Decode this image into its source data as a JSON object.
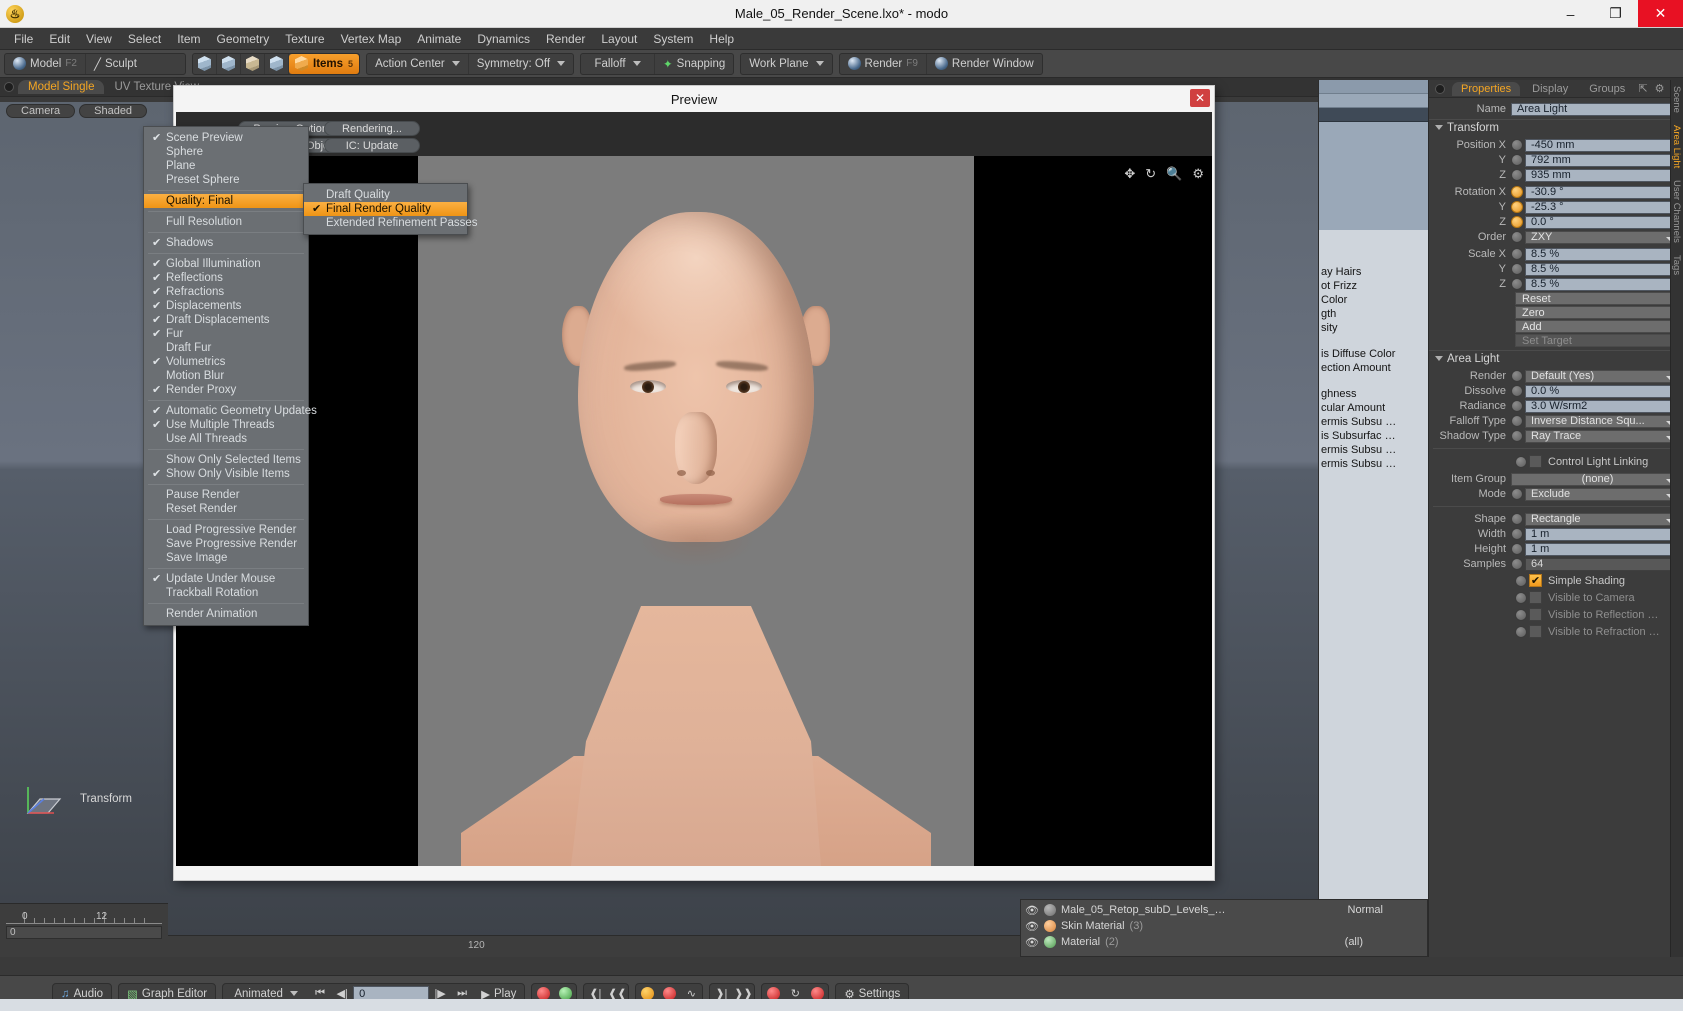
{
  "window": {
    "title": "Male_05_Render_Scene.lxo* - modo",
    "minimize": "–",
    "maximize": "❐",
    "close": "✕"
  },
  "menubar": [
    "File",
    "Edit",
    "View",
    "Select",
    "Item",
    "Geometry",
    "Texture",
    "Vertex Map",
    "Animate",
    "Dynamics",
    "Render",
    "Layout",
    "System",
    "Help"
  ],
  "toolbar": {
    "model": "Model",
    "model_key": "F2",
    "sculpt": "Sculpt",
    "items": "Items",
    "items_badge": "5",
    "action_center": "Action Center",
    "symmetry": "Symmetry: Off",
    "falloff": "Falloff",
    "snapping": "Snapping",
    "work_plane": "Work Plane",
    "render": "Render",
    "render_key": "F9",
    "render_window": "Render Window"
  },
  "layout_tabs": [
    {
      "label": "Model Single",
      "active": true
    },
    {
      "label": "UV Texture View",
      "active": false
    }
  ],
  "viewport": {
    "tabs": [
      "Camera",
      "Shaded"
    ],
    "transform_label": "Transform",
    "ruler_labels": [
      "0",
      "12"
    ],
    "track_value": "0",
    "frame_end": "120"
  },
  "context_menu": {
    "items": [
      {
        "label": "Scene Preview",
        "check": true
      },
      {
        "label": "Sphere",
        "check": false
      },
      {
        "label": "Plane",
        "check": false
      },
      {
        "label": "Preset Sphere",
        "check": false
      },
      {
        "sep": true
      },
      {
        "label": "Quality: Final",
        "check": false,
        "highlight": true,
        "submenu": true
      },
      {
        "sep": true
      },
      {
        "label": "Full Resolution",
        "check": false
      },
      {
        "sep": true
      },
      {
        "label": "Shadows",
        "check": true
      },
      {
        "sep": true
      },
      {
        "label": "Global Illumination",
        "check": true
      },
      {
        "label": "Reflections",
        "check": true
      },
      {
        "label": "Refractions",
        "check": true
      },
      {
        "label": "Displacements",
        "check": true
      },
      {
        "label": "Draft Displacements",
        "check": true
      },
      {
        "label": "Fur",
        "check": true
      },
      {
        "label": "Draft Fur",
        "check": false
      },
      {
        "label": "Volumetrics",
        "check": true
      },
      {
        "label": "Motion Blur",
        "check": false
      },
      {
        "label": "Render Proxy",
        "check": true
      },
      {
        "sep": true
      },
      {
        "label": "Automatic Geometry Updates",
        "check": true
      },
      {
        "label": "Use Multiple Threads",
        "check": true
      },
      {
        "label": "Use All Threads",
        "check": false
      },
      {
        "sep": true
      },
      {
        "label": "Show Only Selected Items",
        "check": false
      },
      {
        "label": "Show Only Visible Items",
        "check": true
      },
      {
        "sep": true
      },
      {
        "label": "Pause Render",
        "check": false
      },
      {
        "label": "Reset Render",
        "check": false
      },
      {
        "sep": true
      },
      {
        "label": "Load Progressive Render",
        "check": false
      },
      {
        "label": "Save Progressive Render",
        "check": false
      },
      {
        "label": "Save Image",
        "check": false
      },
      {
        "sep": true
      },
      {
        "label": "Update Under Mouse",
        "check": true
      },
      {
        "label": "Trackball Rotation",
        "check": false
      },
      {
        "sep": true
      },
      {
        "label": "Render Animation",
        "check": false
      }
    ]
  },
  "submenu": {
    "items": [
      {
        "label": "Draft Quality",
        "check": false
      },
      {
        "label": "Final Render Quality",
        "check": true,
        "highlight": true
      },
      {
        "label": "Extended Refinement Passes",
        "check": false
      }
    ]
  },
  "preview": {
    "title": "Preview",
    "close": "✕",
    "buttons": [
      "Preview Options...",
      "Bake From Object...",
      "Rendering...",
      "IC: Update"
    ],
    "icons": [
      "move-icon",
      "rotate-icon",
      "zoom-icon",
      "gear-icon"
    ]
  },
  "properties": {
    "tabs": [
      {
        "label": "Properties",
        "active": true
      },
      {
        "label": "Display",
        "active": false
      },
      {
        "label": "Groups",
        "active": false
      }
    ],
    "name_label": "Name",
    "name_value": "Area Light",
    "transform_section": "Transform",
    "transform_rows": [
      {
        "label": "Position X",
        "value": "-450 mm",
        "hot": false
      },
      {
        "label": "Y",
        "value": "792 mm",
        "hot": false
      },
      {
        "label": "Z",
        "value": "935 mm",
        "hot": false
      },
      {
        "label": "Rotation X",
        "value": "-30.9 °",
        "hot": true
      },
      {
        "label": "Y",
        "value": "-25.3 °",
        "hot": true
      },
      {
        "label": "Z",
        "value": "0.0 °",
        "hot": true
      }
    ],
    "order_label": "Order",
    "order_value": "ZXY",
    "scale_rows": [
      {
        "label": "Scale X",
        "value": "8.5 %"
      },
      {
        "label": "Y",
        "value": "8.5 %"
      },
      {
        "label": "Z",
        "value": "8.5 %"
      }
    ],
    "transform_buttons": [
      "Reset",
      "Zero",
      "Add"
    ],
    "set_target": "Set Target",
    "arealight_section": "Area Light",
    "arealight_rows": [
      {
        "label": "Render",
        "value": "Default (Yes)",
        "type": "drop"
      },
      {
        "label": "Dissolve",
        "value": "0.0 %",
        "type": "field"
      },
      {
        "label": "Radiance",
        "value": "3.0 W/srm2",
        "type": "field"
      },
      {
        "label": "Falloff Type",
        "value": "Inverse Distance Squ...",
        "type": "drop"
      },
      {
        "label": "Shadow Type",
        "value": "Ray Trace",
        "type": "drop"
      }
    ],
    "control_light_linking": "Control Light Linking",
    "item_group_label": "Item Group",
    "item_group_value": "(none)",
    "mode_label": "Mode",
    "mode_value": "Exclude",
    "shape_rows": [
      {
        "label": "Shape",
        "value": "Rectangle",
        "type": "drop"
      },
      {
        "label": "Width",
        "value": "1 m",
        "type": "field"
      },
      {
        "label": "Height",
        "value": "1 m",
        "type": "field"
      },
      {
        "label": "Samples",
        "value": "64",
        "type": "field"
      }
    ],
    "checkboxes": [
      {
        "label": "Simple Shading",
        "on": true
      },
      {
        "label": "Visible to Camera",
        "on": false
      },
      {
        "label": "Visible to Reflection",
        "on": false,
        "suffix": "…"
      },
      {
        "label": "Visible to Refraction",
        "on": false,
        "suffix": "…"
      }
    ],
    "side_tabs": [
      "Scene",
      "Area Light",
      "User Channels",
      "Tags"
    ]
  },
  "shader_list": {
    "partial_labels": [
      "ay Hairs",
      "ot Frizz",
      " Color",
      "gth",
      "sity",
      "is Diffuse Color",
      "ection Amount",
      "ghness",
      "cular Amount",
      "ermis Subsu …",
      "is Subsurfac …",
      "ermis Subsu …",
      "ermis Subsu …"
    ]
  },
  "item_list": {
    "rows": [
      {
        "name": "Male_05_Retop_subD_Levels_…",
        "count": "",
        "extra": "Normal"
      },
      {
        "name": "Skin Material",
        "count": "(3)",
        "extra": ""
      },
      {
        "name": "Material",
        "count": "(2)",
        "extra": "(all)"
      }
    ]
  },
  "bottombar": {
    "audio": "Audio",
    "graph_editor": "Graph Editor",
    "animated": "Animated",
    "frame_value": "0",
    "play": "Play",
    "settings": "Settings"
  }
}
